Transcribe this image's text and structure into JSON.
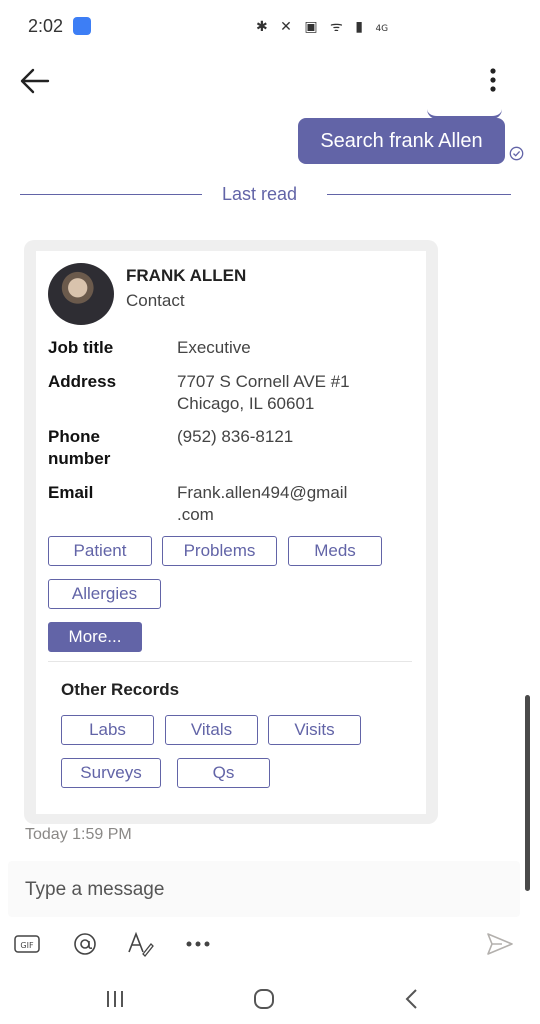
{
  "status_bar": {
    "time": "2:02",
    "icons": "✱ ✕ ▣ ᯤ ▮",
    "network_label": "4G"
  },
  "header": {
    "back_icon": "back-arrow-icon",
    "menu_icon": "more-vertical-icon"
  },
  "sent_message": {
    "text": "Search frank Allen",
    "status_icon": "read-check-icon"
  },
  "divider": {
    "label": "Last read"
  },
  "contact_card": {
    "name": "FRANK ALLEN",
    "type": "Contact",
    "fields": [
      {
        "label": "Job title",
        "value": "Executive"
      },
      {
        "label": "Address",
        "value_lines": [
          "7707 S Cornell AVE #1",
          "Chicago, IL 60601"
        ]
      },
      {
        "label_lines": [
          "Phone",
          "number"
        ],
        "value": "(952) 836-8121"
      },
      {
        "label": "Email",
        "value_lines": [
          "Frank.allen494@gmail",
          ".com"
        ]
      }
    ],
    "actions": [
      "Patient",
      "Problems",
      "Meds",
      "Allergies"
    ],
    "more_label": "More...",
    "other_records_title": "Other Records",
    "other_records": [
      "Labs",
      "Vitals",
      "Visits",
      "Surveys",
      "Qs"
    ]
  },
  "timestamp": "Today 1:59 PM",
  "composer": {
    "placeholder": "Type a message",
    "tools": [
      "gif-icon",
      "mention-icon",
      "format-icon",
      "more-horizontal-icon"
    ],
    "send_icon": "send-icon"
  },
  "accent_color": "#6264a7"
}
